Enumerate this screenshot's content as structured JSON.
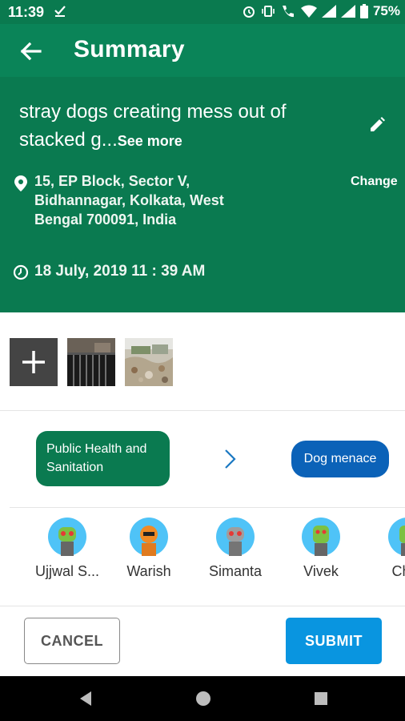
{
  "status_bar": {
    "time": "11:39",
    "battery": "75%"
  },
  "app_bar": {
    "title": "Summary"
  },
  "summary": {
    "description": "stray dogs creating mess out of stacked g...",
    "see_more": "See more",
    "address": "15, EP Block, Sector V, Bidhannagar, Kolkata, West Bengal 700091, India",
    "change_label": "Change",
    "datetime": "18 July, 2019 11 : 39 AM"
  },
  "categories": {
    "primary": "Public Health and Sanitation",
    "secondary": "Dog menace"
  },
  "people": [
    {
      "name": "Ujjwal  S...",
      "color": "#7cc142"
    },
    {
      "name": "Warish",
      "color": "#f08a24"
    },
    {
      "name": "Simanta",
      "color": "#9e9e9e"
    },
    {
      "name": "Vivek",
      "color": "#7cc142"
    },
    {
      "name": "Char",
      "color": "#7cc142"
    }
  ],
  "actions": {
    "cancel": "CANCEL",
    "submit": "SUBMIT"
  },
  "colors": {
    "primary": "#0a7a50",
    "accent": "#0995e0",
    "chip_blue": "#0b62b8"
  }
}
